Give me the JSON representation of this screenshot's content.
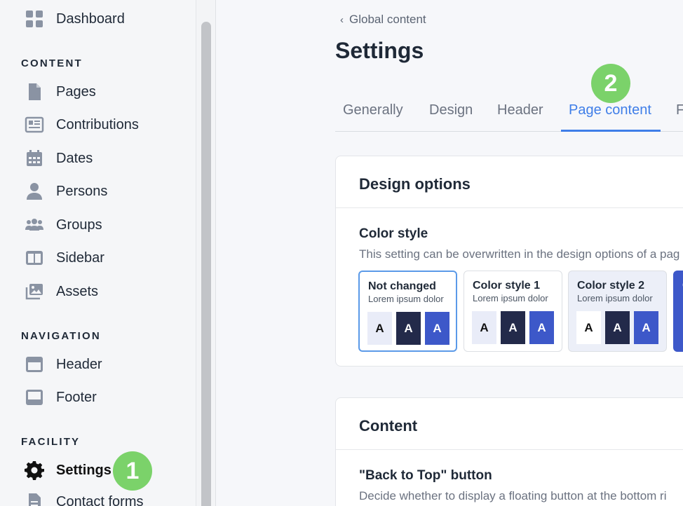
{
  "sidebar": {
    "top_item": {
      "label": "Dashboard",
      "icon": "grid-icon"
    },
    "sections": [
      {
        "label": "CONTENT"
      },
      {
        "label": "NAVIGATION"
      },
      {
        "label": "FACILITY"
      }
    ],
    "content_items": [
      {
        "label": "Pages",
        "icon": "page-icon"
      },
      {
        "label": "Contributions",
        "icon": "newspaper-icon"
      },
      {
        "label": "Dates",
        "icon": "calendar-icon"
      },
      {
        "label": "Persons",
        "icon": "person-icon"
      },
      {
        "label": "Groups",
        "icon": "group-icon"
      },
      {
        "label": "Sidebar",
        "icon": "sidebar-layout-icon"
      },
      {
        "label": "Assets",
        "icon": "images-icon"
      }
    ],
    "navigation_items": [
      {
        "label": "Header",
        "icon": "header-layout-icon"
      },
      {
        "label": "Footer",
        "icon": "footer-layout-icon"
      }
    ],
    "facility_items": [
      {
        "label": "Settings",
        "icon": "gear-icon",
        "active": true
      },
      {
        "label": "Contact forms",
        "icon": "form-icon"
      }
    ]
  },
  "badges": {
    "one": "1",
    "two": "2",
    "color": "#7bd26a"
  },
  "main": {
    "breadcrumb": "Global content",
    "title": "Settings",
    "tabs": [
      {
        "label": "Generally"
      },
      {
        "label": "Design"
      },
      {
        "label": "Header"
      },
      {
        "label": "Page content",
        "active": true
      },
      {
        "label": "F"
      }
    ],
    "design_card": {
      "title": "Design options",
      "field_title": "Color style",
      "field_desc": "This setting can be overwritten in the design options of a pag",
      "swatches": [
        {
          "name": "Not changed",
          "sub": "Lorem ipsum dolor",
          "chip": "A"
        },
        {
          "name": "Color style 1",
          "sub": "Lorem ipsum dolor",
          "chip": "A"
        },
        {
          "name": "Color style 2",
          "sub": "Lorem ipsum dolor",
          "chip": "A"
        },
        {
          "name": "C",
          "sub": "L"
        }
      ]
    },
    "content_card": {
      "title": "Content",
      "field_title": "\"Back to Top\" button",
      "field_desc": "Decide whether to display a floating button at the bottom ri"
    }
  },
  "colors": {
    "accent": "#3f7ee8",
    "dark_chip": "#232a4a",
    "blue_chip": "#3d58c9",
    "light_chip": "#e9ecf8"
  }
}
